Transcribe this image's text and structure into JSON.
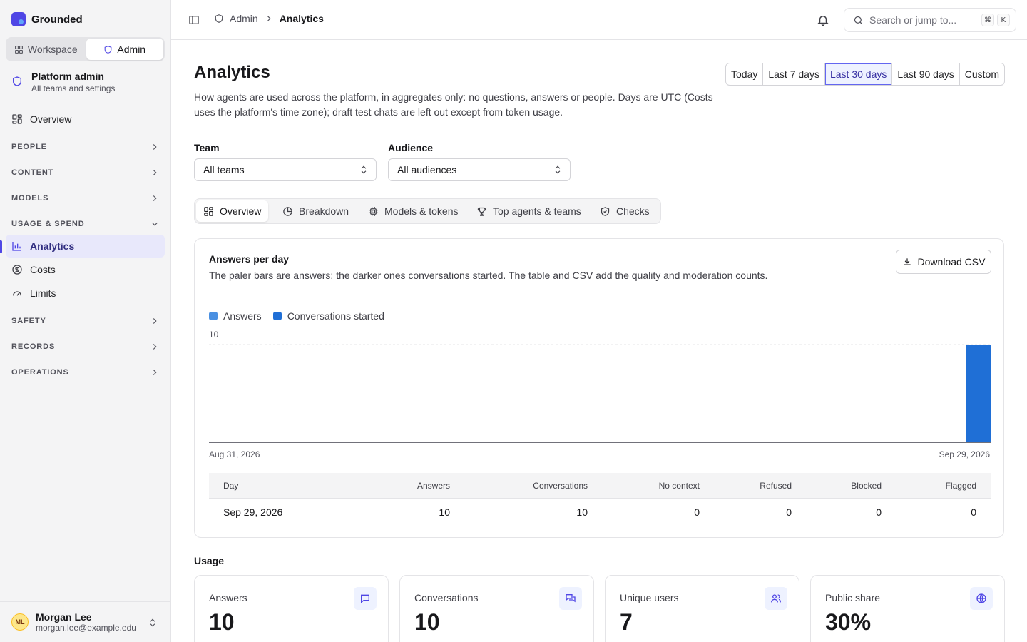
{
  "brand": {
    "name": "Grounded"
  },
  "switcher": {
    "workspace": "Workspace",
    "admin": "Admin"
  },
  "context": {
    "title": "Platform admin",
    "subtitle": "All teams and settings"
  },
  "nav": {
    "overview": "Overview",
    "sections": {
      "people": "PEOPLE",
      "content": "CONTENT",
      "models": "MODELS",
      "usage": "USAGE & SPEND",
      "safety": "SAFETY",
      "records": "RECORDS",
      "operations": "OPERATIONS"
    },
    "usage_items": {
      "analytics": "Analytics",
      "costs": "Costs",
      "limits": "Limits"
    }
  },
  "user": {
    "initials": "ML",
    "name": "Morgan Lee",
    "email": "morgan.lee@example.edu"
  },
  "breadcrumb": {
    "parent": "Admin",
    "current": "Analytics"
  },
  "search": {
    "placeholder": "Search or jump to...",
    "kbd_cmd": "⌘",
    "kbd_key": "K"
  },
  "page": {
    "title": "Analytics",
    "description": "How agents are used across the platform, in aggregates only: no questions, answers or people. Days are UTC (Costs uses the platform's time zone); draft test chats are left out except from token usage."
  },
  "ranges": [
    "Today",
    "Last 7 days",
    "Last 30 days",
    "Last 90 days",
    "Custom"
  ],
  "selected_range": "Last 30 days",
  "filters": {
    "team_label": "Team",
    "team_value": "All teams",
    "audience_label": "Audience",
    "audience_value": "All audiences"
  },
  "tabs": {
    "overview": "Overview",
    "breakdown": "Breakdown",
    "models": "Models & tokens",
    "top": "Top agents & teams",
    "checks": "Checks"
  },
  "answers_card": {
    "title": "Answers per day",
    "subtitle": "The paler bars are answers; the darker ones conversations started. The table and CSV add the quality and moderation counts.",
    "download_label": "Download CSV"
  },
  "colors": {
    "accent": "#4f46e5",
    "answers": "#4a90e2",
    "conversations": "#1f6fd6"
  },
  "chart_data": {
    "type": "bar",
    "x_start": "Aug 31, 2026",
    "x_end": "Sep 29, 2026",
    "days": 30,
    "ylim": [
      0,
      10
    ],
    "y_tick": "10",
    "legend_position": "top-left",
    "series": [
      {
        "name": "Answers",
        "color": "#4a90e2",
        "points": [
          {
            "day": "Sep 29, 2026",
            "value": 10
          }
        ]
      },
      {
        "name": "Conversations started",
        "color": "#1f6fd6",
        "points": [
          {
            "day": "Sep 29, 2026",
            "value": 10
          }
        ]
      }
    ]
  },
  "table": {
    "headers": [
      "Day",
      "Answers",
      "Conversations",
      "No context",
      "Refused",
      "Blocked",
      "Flagged"
    ],
    "rows": [
      [
        "Sep 29, 2026",
        "10",
        "10",
        "0",
        "0",
        "0",
        "0"
      ]
    ]
  },
  "usage": {
    "title": "Usage",
    "stats": [
      {
        "label": "Answers",
        "value": "10",
        "icon": "message-square-icon"
      },
      {
        "label": "Conversations",
        "value": "10",
        "icon": "messages-icon"
      },
      {
        "label": "Unique users",
        "value": "7",
        "icon": "users-icon"
      },
      {
        "label": "Public share",
        "value": "30%",
        "icon": "globe-icon"
      }
    ]
  }
}
